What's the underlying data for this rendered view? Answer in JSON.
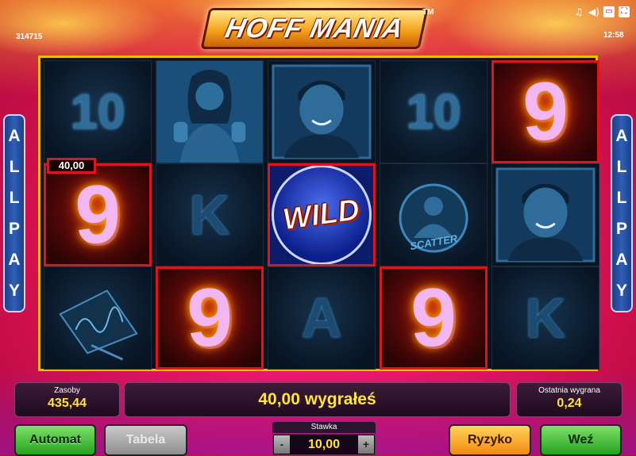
{
  "header": {
    "logo_text": "HOFF MANIA",
    "trademark": "TM",
    "session_id": "314715",
    "clock": "12:58",
    "icons": {
      "music": "♫",
      "sound": "◀)",
      "window": "▭",
      "fullscreen": "⛶"
    }
  },
  "side_banners": {
    "left": [
      "A",
      "L",
      "L",
      "P",
      "A",
      "Y"
    ],
    "right": [
      "A",
      "L",
      "L",
      "P",
      "A",
      "Y"
    ]
  },
  "reels": {
    "symbols": {
      "ten": "10",
      "nine": "9",
      "k": "K",
      "a": "A",
      "wild": "WILD",
      "scatter": "SCATTER"
    },
    "win_label": "40,00"
  },
  "status": {
    "balance_label": "Zasoby",
    "balance_value": "435,44",
    "win_message": "40,00 wygrałeś",
    "last_win_label": "Ostatnia wygrana",
    "last_win_value": "0,24"
  },
  "controls": {
    "auto_label": "Automat",
    "table_label": "Tabela",
    "stake_label": "Stawka",
    "stake_value": "10,00",
    "stake_minus": "-",
    "stake_plus": "+",
    "risk_label": "Ryzyko",
    "take_label": "Weź"
  },
  "colors": {
    "accent_yellow": "#ffe43a",
    "win_red": "#e0141c",
    "reel_frame": "#e8c000"
  }
}
